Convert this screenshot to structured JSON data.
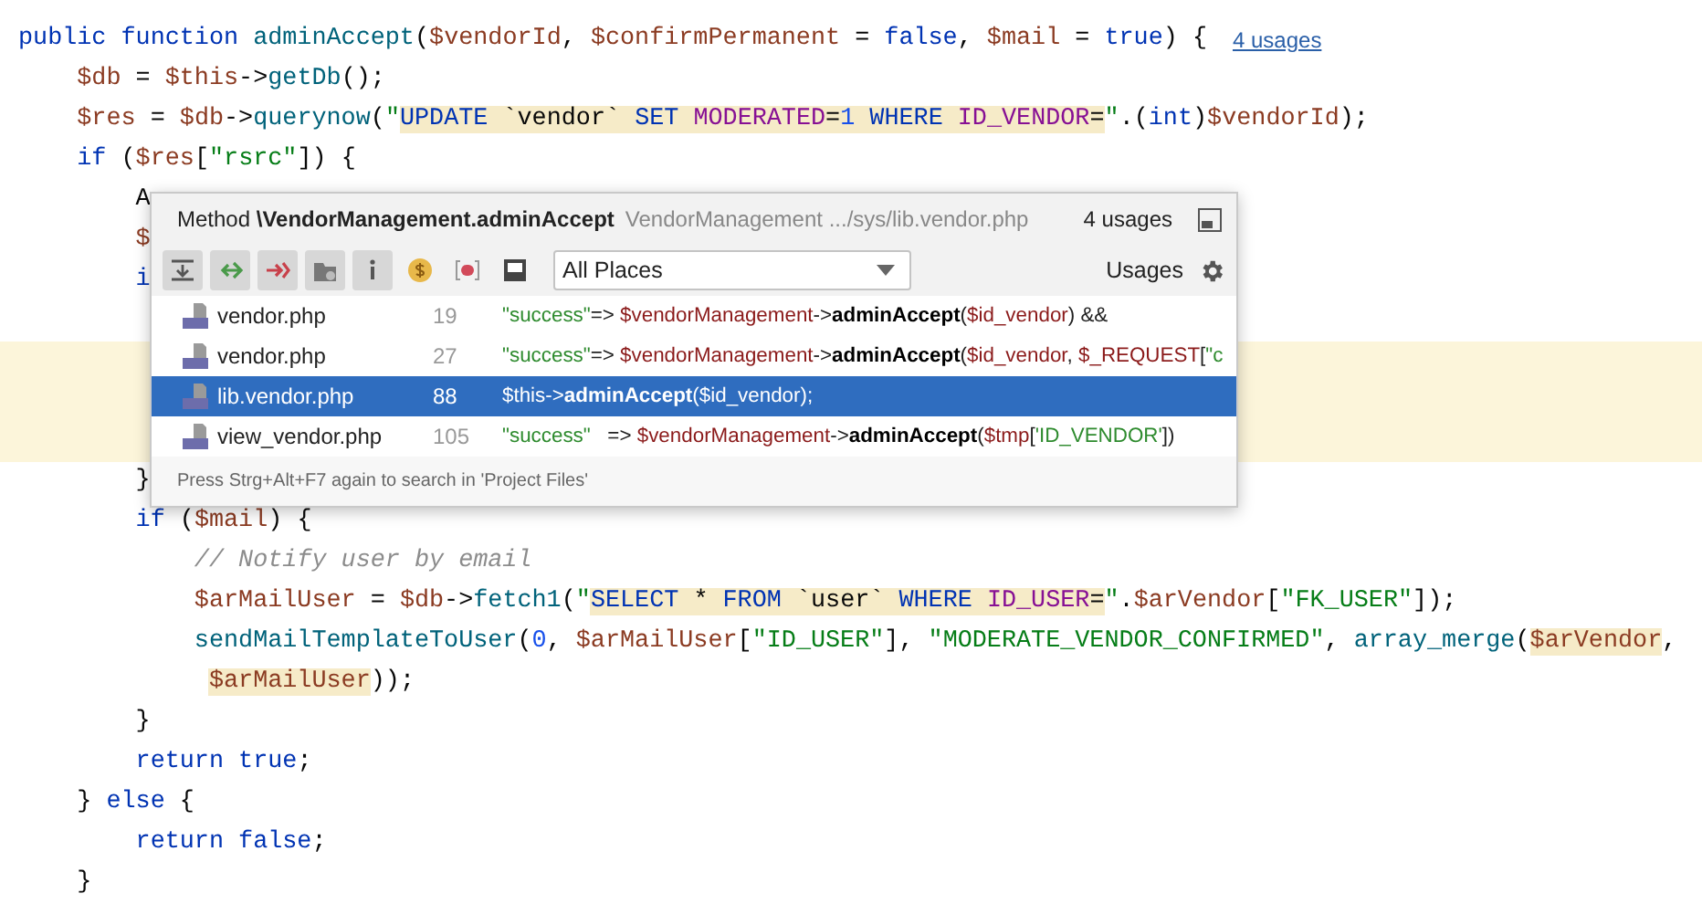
{
  "editor": {
    "lines": [
      {
        "marked": false,
        "inlay": "4 usages",
        "tokens": [
          {
            "kind": "kw",
            "text": "public "
          },
          {
            "kind": "kw",
            "text": "function "
          },
          {
            "kind": "fn",
            "text": "adminAccept"
          },
          {
            "kind": "plain",
            "text": "("
          },
          {
            "kind": "var",
            "text": "$vendorId"
          },
          {
            "kind": "plain",
            "text": ", "
          },
          {
            "kind": "var",
            "text": "$confirmPermanent"
          },
          {
            "kind": "plain",
            "text": " = "
          },
          {
            "kind": "kw",
            "text": "false"
          },
          {
            "kind": "plain",
            "text": ", "
          },
          {
            "kind": "var",
            "text": "$mail"
          },
          {
            "kind": "plain",
            "text": " = "
          },
          {
            "kind": "kw",
            "text": "true"
          },
          {
            "kind": "plain",
            "text": ") {"
          }
        ]
      },
      {
        "marked": false,
        "tokens": [
          {
            "kind": "var",
            "text": "    $db"
          },
          {
            "kind": "plain",
            "text": " = "
          },
          {
            "kind": "var",
            "text": "$this"
          },
          {
            "kind": "plain",
            "text": "->"
          },
          {
            "kind": "fn",
            "text": "getDb"
          },
          {
            "kind": "plain",
            "text": "();"
          }
        ]
      },
      {
        "marked": false,
        "tokens": [
          {
            "kind": "var",
            "text": "    $res"
          },
          {
            "kind": "plain",
            "text": " = "
          },
          {
            "kind": "var",
            "text": "$db"
          },
          {
            "kind": "plain",
            "text": "->"
          },
          {
            "kind": "fn",
            "text": "querynow"
          },
          {
            "kind": "plain",
            "text": "("
          },
          {
            "kind": "str",
            "text": "\""
          },
          {
            "kind": "inject",
            "children": [
              {
                "kind": "sqlkw",
                "text": "UPDATE"
              },
              {
                "kind": "plain",
                "text": " `vendor` "
              },
              {
                "kind": "sqlkw",
                "text": "SET "
              },
              {
                "kind": "sqlid",
                "text": "MODERATED"
              },
              {
                "kind": "plain",
                "text": "="
              },
              {
                "kind": "num",
                "text": "1 "
              },
              {
                "kind": "sqlkw",
                "text": "WHERE "
              },
              {
                "kind": "sqlid",
                "text": "ID_VENDOR"
              },
              {
                "kind": "plain",
                "text": "="
              }
            ]
          },
          {
            "kind": "str",
            "text": "\""
          },
          {
            "kind": "plain",
            "text": ".("
          },
          {
            "kind": "kw",
            "text": "int"
          },
          {
            "kind": "plain",
            "text": ")"
          },
          {
            "kind": "var",
            "text": "$vendorId"
          },
          {
            "kind": "plain",
            "text": ");"
          }
        ]
      },
      {
        "marked": false,
        "tokens": [
          {
            "kind": "kw",
            "text": "    if "
          },
          {
            "kind": "plain",
            "text": "("
          },
          {
            "kind": "var",
            "text": "$res"
          },
          {
            "kind": "plain",
            "text": "["
          },
          {
            "kind": "str",
            "text": "\"rsrc\""
          },
          {
            "kind": "plain",
            "text": "]) {"
          }
        ]
      },
      {
        "marked": false,
        "tokens": [
          {
            "kind": "plain",
            "text": "        A"
          }
        ]
      },
      {
        "marked": false,
        "tokens": [
          {
            "kind": "var",
            "text": "        $"
          }
        ]
      },
      {
        "marked": false,
        "tokens": [
          {
            "kind": "kw",
            "text": "        i"
          }
        ]
      },
      {
        "marked": false
      },
      {
        "marked": true
      },
      {
        "marked": true
      },
      {
        "marked": true
      },
      {
        "marked": false,
        "tokens": [
          {
            "kind": "plain",
            "text": "        }"
          }
        ]
      },
      {
        "marked": false,
        "tokens": [
          {
            "kind": "kw",
            "text": "        if "
          },
          {
            "kind": "plain",
            "text": "("
          },
          {
            "kind": "var",
            "text": "$mail"
          },
          {
            "kind": "plain",
            "text": ") {"
          }
        ]
      },
      {
        "marked": false,
        "tokens": [
          {
            "kind": "comment",
            "text": "            // Notify user by email"
          }
        ]
      },
      {
        "marked": false,
        "tokens": [
          {
            "kind": "var",
            "text": "            $arMailUser"
          },
          {
            "kind": "plain",
            "text": " = "
          },
          {
            "kind": "var",
            "text": "$db"
          },
          {
            "kind": "plain",
            "text": "->"
          },
          {
            "kind": "fn",
            "text": "fetch1"
          },
          {
            "kind": "plain",
            "text": "("
          },
          {
            "kind": "str",
            "text": "\""
          },
          {
            "kind": "inject",
            "children": [
              {
                "kind": "sqlkw",
                "text": "SELECT"
              },
              {
                "kind": "plain",
                "text": " * "
              },
              {
                "kind": "sqlkw",
                "text": "FROM"
              },
              {
                "kind": "plain",
                "text": " `user` "
              },
              {
                "kind": "sqlkw",
                "text": "WHERE "
              },
              {
                "kind": "sqlid",
                "text": "ID_USER"
              },
              {
                "kind": "plain",
                "text": "="
              }
            ]
          },
          {
            "kind": "str",
            "text": "\""
          },
          {
            "kind": "plain",
            "text": "."
          },
          {
            "kind": "var",
            "text": "$arVendor"
          },
          {
            "kind": "plain",
            "text": "["
          },
          {
            "kind": "str",
            "text": "\"FK_USER\""
          },
          {
            "kind": "plain",
            "text": "]);"
          }
        ]
      },
      {
        "marked": false,
        "tokens": [
          {
            "kind": "fn",
            "text": "            sendMailTemplateToUser"
          },
          {
            "kind": "plain",
            "text": "("
          },
          {
            "kind": "num",
            "text": "0"
          },
          {
            "kind": "plain",
            "text": ", "
          },
          {
            "kind": "var",
            "text": "$arMailUser"
          },
          {
            "kind": "plain",
            "text": "["
          },
          {
            "kind": "str",
            "text": "\"ID_USER\""
          },
          {
            "kind": "plain",
            "text": "], "
          },
          {
            "kind": "str",
            "text": "\"MODERATE_VENDOR_CONFIRMED\""
          },
          {
            "kind": "plain",
            "text": ", "
          },
          {
            "kind": "fn",
            "text": "array_merge"
          },
          {
            "kind": "plain",
            "text": "("
          },
          {
            "kind": "inject",
            "children": [
              {
                "kind": "var",
                "text": "$arVendor"
              }
            ]
          },
          {
            "kind": "plain",
            "text": ","
          }
        ]
      },
      {
        "marked": false,
        "tokens": [
          {
            "kind": "inject",
            "children": [
              {
                "kind": "var",
                "text": "             $arMailUser"
              }
            ]
          },
          {
            "kind": "plain",
            "text": "));"
          }
        ]
      },
      {
        "marked": false,
        "tokens": [
          {
            "kind": "plain",
            "text": "        }"
          }
        ]
      },
      {
        "marked": false,
        "tokens": [
          {
            "kind": "kw",
            "text": "        return true"
          },
          {
            "kind": "plain",
            "text": ";"
          }
        ]
      },
      {
        "marked": false,
        "tokens": [
          {
            "kind": "plain",
            "text": "    } "
          },
          {
            "kind": "kw",
            "text": "else"
          },
          {
            "kind": "plain",
            "text": " {"
          }
        ]
      },
      {
        "marked": false,
        "tokens": [
          {
            "kind": "kw",
            "text": "        return false"
          },
          {
            "kind": "plain",
            "text": ";"
          }
        ]
      },
      {
        "marked": false,
        "tokens": [
          {
            "kind": "plain",
            "text": "    }"
          }
        ]
      }
    ]
  },
  "popup": {
    "title": "Method **\\VendorManagement.adminAccept**",
    "location": "VendorManagement .../sys/lib.vendor.php",
    "count": "4 usages",
    "toolbar": [
      {
        "pressed": true
      },
      {
        "pressed": true
      },
      {
        "pressed": true
      },
      {
        "pressed": true
      },
      {
        "pressed": true
      },
      {
        "pressed": false
      },
      {
        "pressed": false
      },
      {
        "pressed": false
      }
    ],
    "scope": "All Places",
    "usages_label": "Usages",
    "rows": [
      {
        "file": "vendor.php",
        "line": "19",
        "selected": false,
        "code": [
          {
            "kind": "str",
            "text": "\"success\""
          },
          {
            "kind": "plain",
            "text": "=> "
          },
          {
            "kind": "var",
            "text": "$vendorManagement"
          },
          {
            "kind": "plain",
            "text": "->"
          },
          {
            "kind": "method",
            "text": "adminAccept"
          },
          {
            "kind": "plain",
            "text": "("
          },
          {
            "kind": "var",
            "text": "$id_vendor"
          },
          {
            "kind": "plain",
            "text": ") &&"
          }
        ]
      },
      {
        "file": "vendor.php",
        "line": "27",
        "selected": false,
        "code": [
          {
            "kind": "str",
            "text": "\"success\""
          },
          {
            "kind": "plain",
            "text": "=> "
          },
          {
            "kind": "var",
            "text": "$vendorManagement"
          },
          {
            "kind": "plain",
            "text": "->"
          },
          {
            "kind": "method",
            "text": "adminAccept"
          },
          {
            "kind": "plain",
            "text": "("
          },
          {
            "kind": "var",
            "text": "$id_vendor"
          },
          {
            "kind": "plain",
            "text": ", "
          },
          {
            "kind": "var",
            "text": "$_REQUEST"
          },
          {
            "kind": "plain",
            "text": "["
          },
          {
            "kind": "str",
            "text": "\"c"
          }
        ]
      },
      {
        "file": "lib.vendor.php",
        "line": "88",
        "selected": true,
        "code": [
          {
            "kind": "var",
            "text": "$this"
          },
          {
            "kind": "plain",
            "text": "->"
          },
          {
            "kind": "method",
            "text": "adminAccept"
          },
          {
            "kind": "plain",
            "text": "("
          },
          {
            "kind": "var",
            "text": "$id_vendor"
          },
          {
            "kind": "plain",
            "text": ");"
          }
        ]
      },
      {
        "file": "view_vendor.php",
        "line": "105",
        "selected": false,
        "code": [
          {
            "kind": "str",
            "text": "\"success\""
          },
          {
            "kind": "plain",
            "text": "   => "
          },
          {
            "kind": "var",
            "text": "$vendorManagement"
          },
          {
            "kind": "plain",
            "text": "->"
          },
          {
            "kind": "method",
            "text": "adminAccept"
          },
          {
            "kind": "plain",
            "text": "("
          },
          {
            "kind": "var",
            "text": "$tmp"
          },
          {
            "kind": "plain",
            "text": "["
          },
          {
            "kind": "str",
            "text": "'ID_VENDOR'"
          },
          {
            "kind": "plain",
            "text": "])"
          }
        ]
      }
    ],
    "hint": "Press Strg+Alt+F7 again to search in 'Project Files'"
  }
}
